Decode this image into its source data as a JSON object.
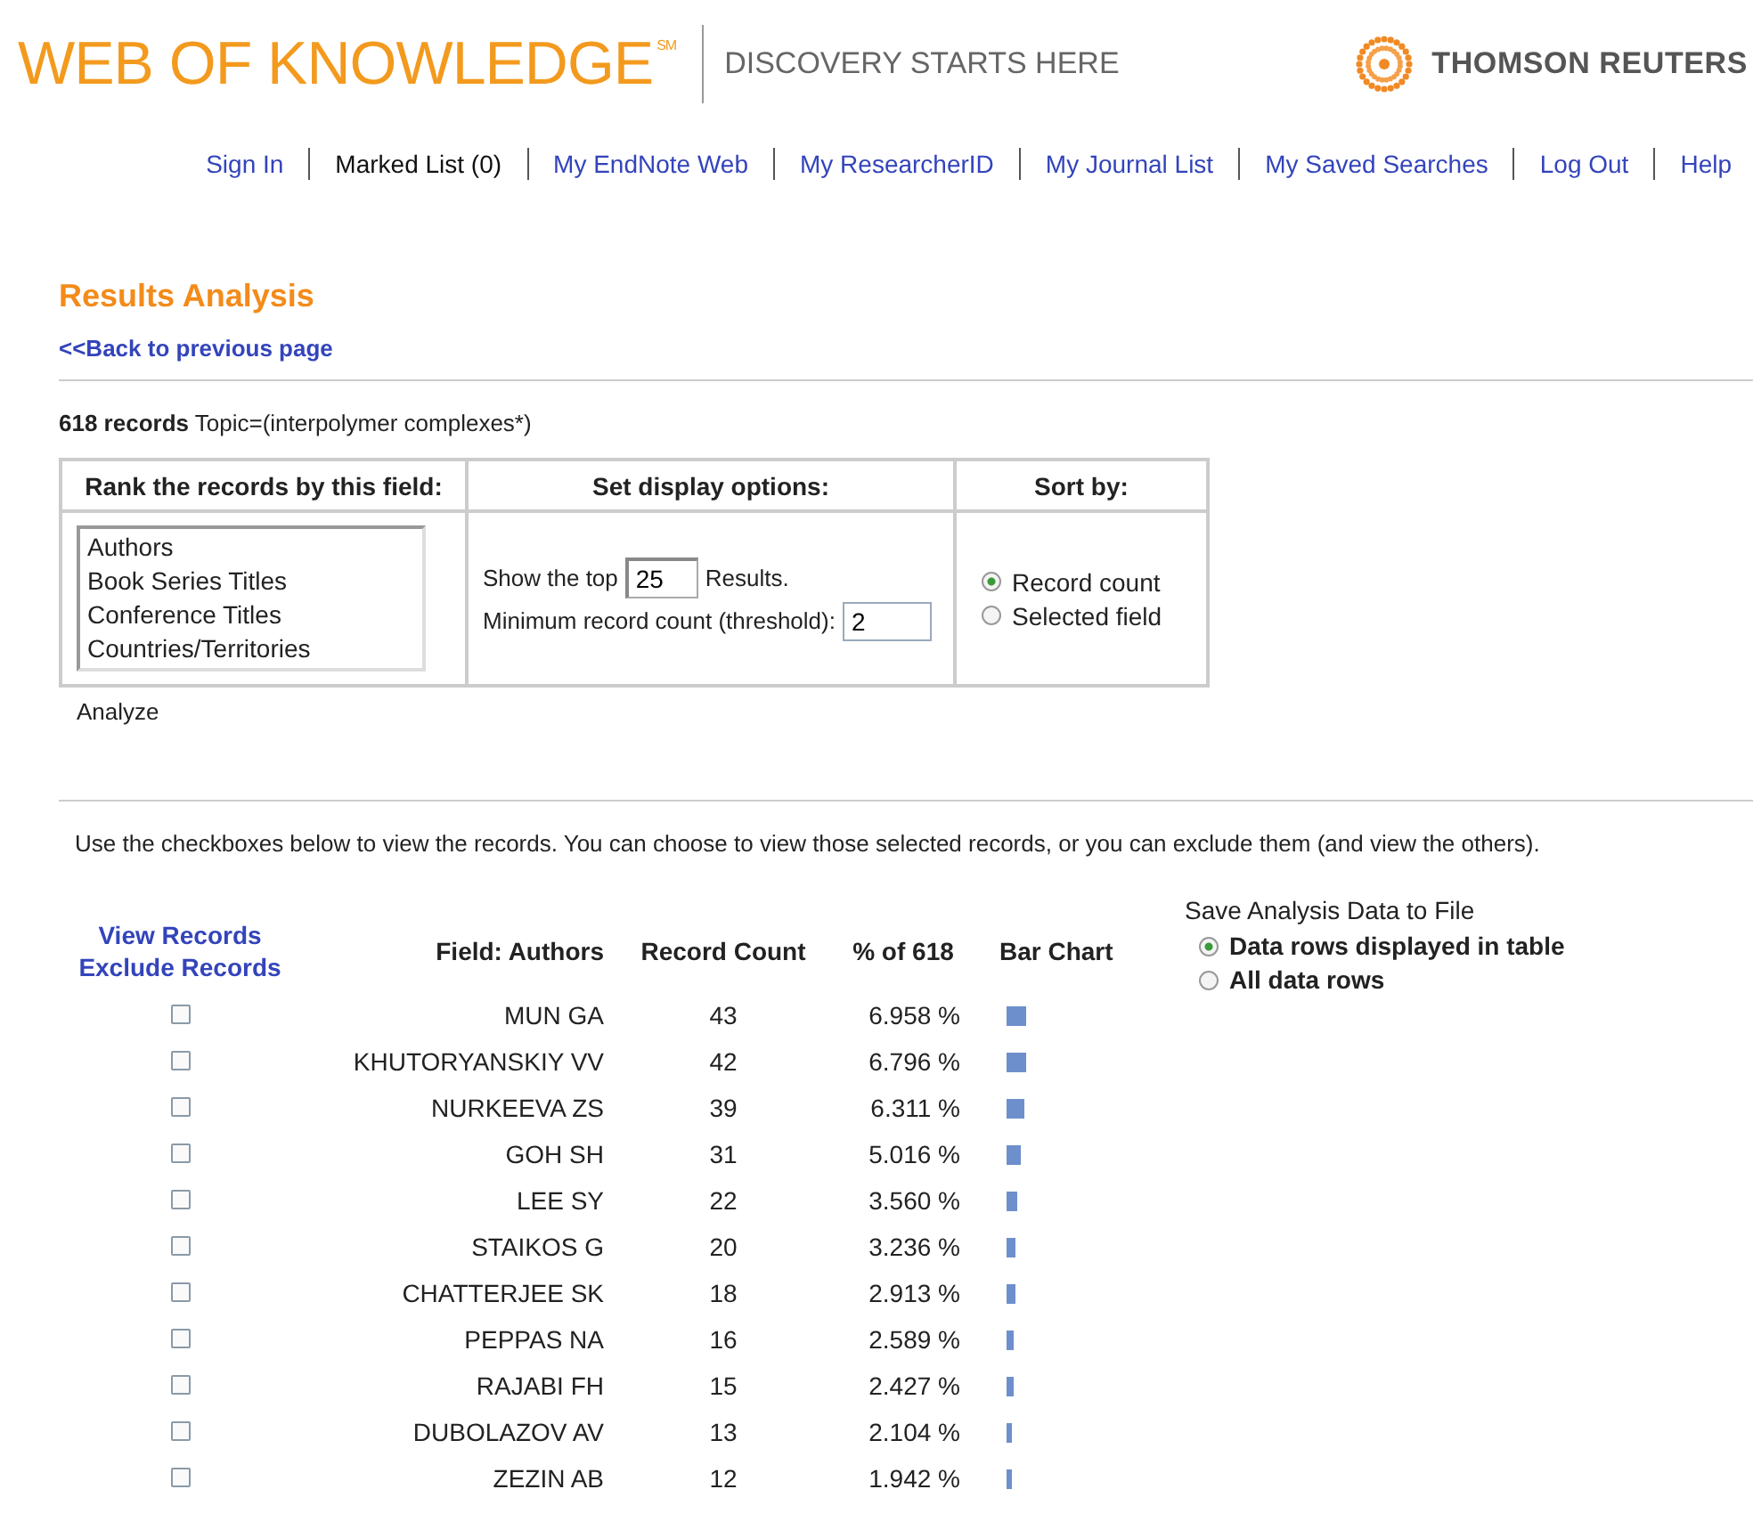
{
  "header": {
    "logo": "WEB OF KNOWLEDGE",
    "logo_mark": "SM",
    "tagline": "DISCOVERY STARTS HERE",
    "brand": "THOMSON REUTERS"
  },
  "nav": [
    {
      "label": "Sign In",
      "kind": "link"
    },
    {
      "label": "Marked List (0)",
      "kind": "text"
    },
    {
      "label": "My EndNote Web",
      "kind": "link"
    },
    {
      "label": "My ResearcherID",
      "kind": "link"
    },
    {
      "label": "My Journal List",
      "kind": "link"
    },
    {
      "label": "My Saved Searches",
      "kind": "link"
    },
    {
      "label": "Log Out",
      "kind": "link"
    },
    {
      "label": "Help",
      "kind": "link"
    }
  ],
  "page_title": "Results Analysis",
  "back_link": "<<Back to previous page",
  "query": {
    "count": "618 records",
    "topic": "Topic=(interpolymer complexes*)"
  },
  "options": {
    "rank_header": "Rank the records by this field:",
    "display_header": "Set display options:",
    "sort_header": "Sort by:",
    "fields": [
      "Authors",
      "Book Series Titles",
      "Conference Titles",
      "Countries/Territories"
    ],
    "show_top_label": "Show the top",
    "show_top_value": "25",
    "results_label": "Results.",
    "min_label": "Minimum record count (threshold):",
    "min_value": "2",
    "sort_options": [
      {
        "label": "Record count",
        "selected": true
      },
      {
        "label": "Selected field",
        "selected": false
      }
    ]
  },
  "analyze": "Analyze",
  "instructions": "Use the checkboxes below to view the records. You can choose to view those selected records, or you can exclude them (and view the others).",
  "results": {
    "view_link": "View Records",
    "exclude_link": "Exclude Records",
    "columns": [
      "Field: Authors",
      "Record Count",
      "% of 618",
      "Bar Chart"
    ],
    "rows": [
      {
        "name": "MUN GA",
        "count": "43",
        "percent": "6.958 %",
        "checked": false
      },
      {
        "name": "KHUTORYANSKIY VV",
        "count": "42",
        "percent": "6.796 %",
        "checked": false
      },
      {
        "name": "NURKEEVA ZS",
        "count": "39",
        "percent": "6.311 %",
        "checked": false
      },
      {
        "name": "GOH SH",
        "count": "31",
        "percent": "5.016 %",
        "checked": false
      },
      {
        "name": "LEE SY",
        "count": "22",
        "percent": "3.560 %",
        "checked": false
      },
      {
        "name": "STAIKOS G",
        "count": "20",
        "percent": "3.236 %",
        "checked": false
      },
      {
        "name": "CHATTERJEE SK",
        "count": "18",
        "percent": "2.913 %",
        "checked": false
      },
      {
        "name": "PEPPAS NA",
        "count": "16",
        "percent": "2.589 %",
        "checked": false
      },
      {
        "name": "RAJABI FH",
        "count": "15",
        "percent": "2.427 %",
        "checked": false
      },
      {
        "name": "DUBOLAZOV AV",
        "count": "13",
        "percent": "2.104 %",
        "checked": false
      },
      {
        "name": "ZEZIN AB",
        "count": "12",
        "percent": "1.942 %",
        "checked": false
      }
    ]
  },
  "save": {
    "title": "Save Analysis Data to File",
    "options": [
      {
        "label": "Data rows displayed in table",
        "selected": true
      },
      {
        "label": "All data rows",
        "selected": false
      }
    ]
  }
}
